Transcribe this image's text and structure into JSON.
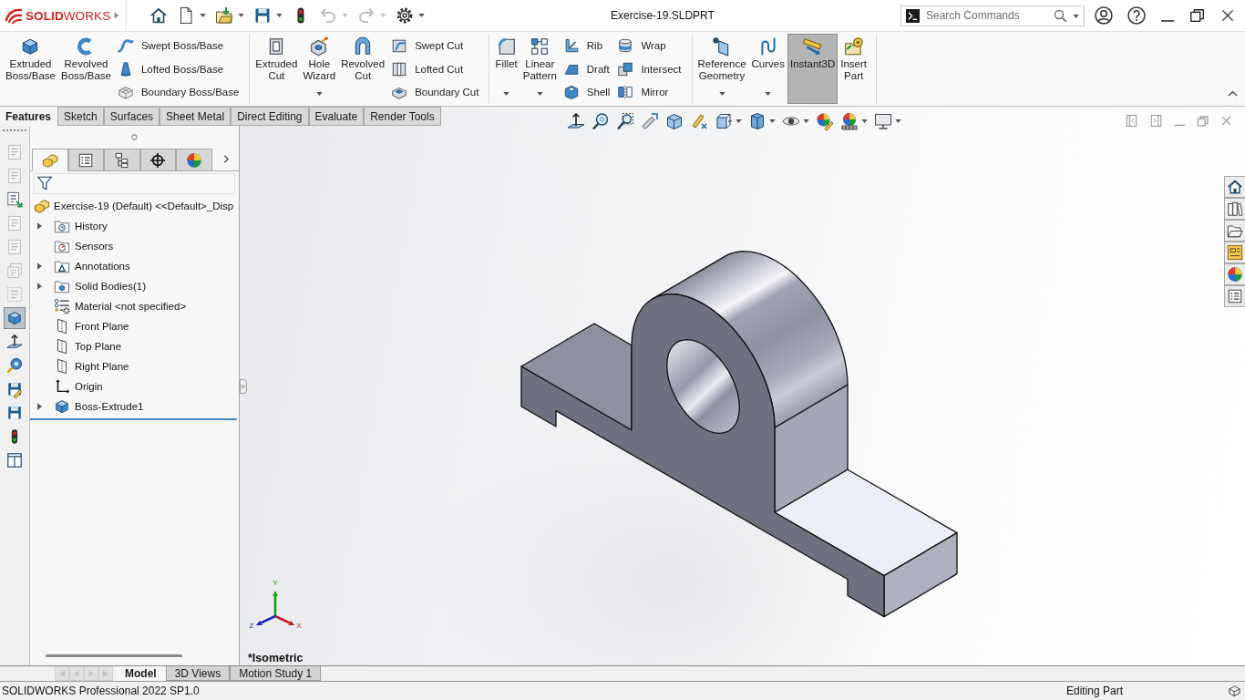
{
  "title_bar": {
    "logo": "**SOLID**WORKS",
    "quick_access": [
      {
        "disabled": false,
        "dropdown": false
      },
      {
        "disabled": false,
        "dropdown": true
      },
      {
        "disabled": false,
        "dropdown": true
      },
      {
        "disabled": false,
        "dropdown": true
      },
      {
        "disabled": false,
        "dropdown": false
      },
      {
        "disabled": true,
        "dropdown": true
      },
      {
        "disabled": true,
        "dropdown": true
      },
      {
        "disabled": false,
        "dropdown": true
      }
    ],
    "document_title": "Exercise-19.SLDPRT",
    "search": {
      "placeholder": "Search Commands"
    }
  },
  "ribbon": {
    "groups": [
      {
        "large": [
          {
            "label": "Extruded Boss/Base",
            "dropdown": false,
            "on": false
          },
          {
            "label": "Revolved Boss/Base",
            "dropdown": false,
            "on": false
          }
        ],
        "small_columns": [
          [
            "Swept Boss/Base",
            "Lofted Boss/Base",
            "Boundary Boss/Base"
          ]
        ]
      },
      {
        "large": [
          {
            "label": "Extruded Cut",
            "dropdown": false,
            "on": false
          },
          {
            "label": "Hole Wizard",
            "dropdown": true,
            "on": false
          },
          {
            "label": "Revolved Cut",
            "dropdown": false,
            "on": false
          }
        ],
        "small_columns": [
          [
            "Swept Cut",
            "Lofted Cut",
            "Boundary Cut"
          ]
        ]
      },
      {
        "large": [
          {
            "label": "Fillet",
            "dropdown": true,
            "on": false
          },
          {
            "label": "Linear Pattern",
            "dropdown": true,
            "on": false
          }
        ],
        "small_columns": [
          [
            "Rib",
            "Draft",
            "Shell"
          ],
          [
            "Wrap",
            "Intersect",
            "Mirror"
          ]
        ]
      },
      {
        "large": [
          {
            "label": "Reference Geometry",
            "dropdown": true,
            "on": false
          },
          {
            "label": "Curves",
            "dropdown": true,
            "on": false
          },
          {
            "label": "Instant3D",
            "dropdown": false,
            "on": true
          },
          {
            "label": "Insert Part",
            "dropdown": false,
            "on": false
          }
        ]
      }
    ]
  },
  "command_tabs": [
    {
      "label": "Features",
      "selected": true
    },
    {
      "label": "Sketch",
      "selected": false
    },
    {
      "label": "Surfaces",
      "selected": false
    },
    {
      "label": "Sheet Metal",
      "selected": false
    },
    {
      "label": "Direct Editing",
      "selected": false
    },
    {
      "label": "Evaluate",
      "selected": false
    },
    {
      "label": "Render Tools",
      "selected": false
    }
  ],
  "left_toolbar": [
    {
      "disabled": true,
      "selected": false
    },
    {
      "disabled": true,
      "selected": false
    },
    {
      "disabled": false,
      "selected": false
    },
    {
      "disabled": true,
      "selected": false
    },
    {
      "disabled": true,
      "selected": false
    },
    {
      "disabled": true,
      "selected": false
    },
    {
      "disabled": true,
      "selected": false
    },
    {
      "disabled": false,
      "selected": true
    },
    {
      "disabled": false,
      "selected": false
    },
    {
      "disabled": false,
      "selected": false
    },
    {
      "disabled": false,
      "selected": false
    },
    {
      "disabled": false,
      "selected": false
    },
    {
      "disabled": false,
      "selected": false
    },
    {
      "disabled": false,
      "selected": false
    }
  ],
  "feature_manager": {
    "tabs": [
      {
        "selected": true
      },
      {
        "selected": false
      },
      {
        "selected": false
      },
      {
        "selected": false
      },
      {
        "selected": false
      }
    ],
    "tree": {
      "label": "Exercise-19 (Default) <<Default>_Disp",
      "children": [
        {
          "label": "History",
          "kind": "history",
          "expandable": true
        },
        {
          "label": "Sensors",
          "kind": "sensors",
          "expandable": false
        },
        {
          "label": "Annotations",
          "kind": "annotations",
          "expandable": true
        },
        {
          "label": "Solid Bodies(1)",
          "kind": "bodies",
          "expandable": true
        },
        {
          "label": "Material <not specified>",
          "kind": "material",
          "expandable": false
        },
        {
          "label": "Front Plane",
          "kind": "plane",
          "expandable": false
        },
        {
          "label": "Top Plane",
          "kind": "plane",
          "expandable": false
        },
        {
          "label": "Right Plane",
          "kind": "plane",
          "expandable": false
        },
        {
          "label": "Origin",
          "kind": "origin",
          "expandable": false
        },
        {
          "label": "Boss-Extrude1",
          "kind": "feature",
          "expandable": true
        }
      ]
    }
  },
  "viewport": {
    "heads_up": [
      {
        "dropdown": false
      },
      {
        "dropdown": false
      },
      {
        "dropdown": false
      },
      {
        "dropdown": false
      },
      {
        "dropdown": false
      },
      {
        "dropdown": false
      },
      {
        "dropdown": true
      },
      {
        "dropdown": true
      },
      {
        "dropdown": true
      },
      {
        "dropdown": false
      },
      {
        "dropdown": true
      },
      {
        "dropdown": true
      }
    ],
    "triad": [
      {
        "label": "Y",
        "color": "#169a16"
      },
      {
        "label": "X",
        "color": "#c41a1a"
      },
      {
        "label": "Z",
        "color": "#1c24b8"
      }
    ],
    "view_name": "*Isometric"
  },
  "bottom_tabs": {
    "nav": [
      {
        "disabled": true
      },
      {
        "disabled": true
      },
      {
        "disabled": true
      },
      {
        "disabled": true
      }
    ],
    "tabs": [
      {
        "label": "Model",
        "selected": true
      },
      {
        "label": "3D Views",
        "selected": false
      },
      {
        "label": "Motion Study 1",
        "selected": false
      }
    ]
  },
  "status_bar": {
    "product": "SOLIDWORKS Professional 2022 SP1.0",
    "mode": "Editing Part"
  }
}
